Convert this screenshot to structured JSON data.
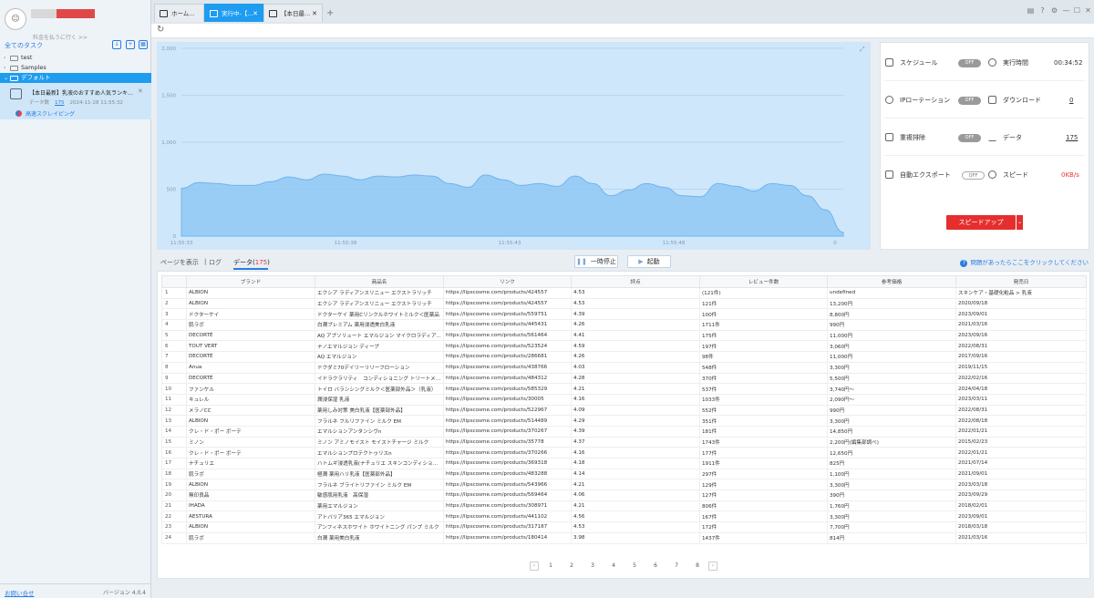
{
  "sidebar": {
    "billing_link": "料金を払うに行く >>",
    "all_tasks": "全てのタスク",
    "folders": [
      {
        "label": "test",
        "chev": "›"
      },
      {
        "label": "Samples",
        "chev": "›"
      },
      {
        "label": "デフォルト",
        "chev": "⌄"
      }
    ],
    "task": {
      "title": "【本日最新】乳液のおすすめ人気ランキング",
      "count_label": "データ数",
      "count": "175",
      "timestamp": "2024-11-28 11:55:32",
      "mode": "高速スクレイピング"
    },
    "contact": "お問い合せ",
    "version": "バージョン 4.0.4"
  },
  "tabs": [
    {
      "label": "ホーム..."
    },
    {
      "label": "実行中-【..."
    },
    {
      "label": "【本日最..."
    }
  ],
  "chart_data": {
    "type": "area",
    "x": [
      "11:55:33",
      "11:55:38",
      "11:55:43",
      "11:55:48"
    ],
    "x_end_label": "0",
    "ylim": [
      0,
      2000
    ],
    "yticks": [
      "2,000",
      "1,500",
      "1,000",
      "500",
      "0"
    ],
    "series": [
      {
        "values": [
          510,
          570,
          560,
          540,
          540,
          580,
          630,
          600,
          660,
          640,
          600,
          640,
          630,
          650,
          640,
          560,
          520,
          650,
          600,
          540,
          560,
          530,
          640,
          560,
          430,
          490,
          560,
          520,
          430,
          420,
          560,
          530,
          480,
          560,
          540,
          430,
          280,
          40
        ]
      }
    ]
  },
  "stats": {
    "schedule": {
      "label": "スケジュール",
      "toggle": "OFF"
    },
    "run_time": {
      "label": "実行時間",
      "value": "00:34:52"
    },
    "ip_rotation": {
      "label": "IPローテーション",
      "toggle": "OFF"
    },
    "download": {
      "label": "ダウンロード",
      "value": "0"
    },
    "dedupe": {
      "label": "重複排除",
      "toggle": "OFF"
    },
    "data": {
      "label": "データ",
      "value": "175"
    },
    "auto_export": {
      "label": "自動エクスポート",
      "toggle": "OFF"
    },
    "speed": {
      "label": "スピード",
      "value": "0KB/s"
    },
    "speedup_button": "スピードアップ"
  },
  "data_tabs": {
    "page": "ページを表示",
    "sep": "|",
    "log": "ログ",
    "data_prefix": "データ(",
    "data_count": "175",
    "data_suffix": ")"
  },
  "controls": {
    "pause": "一時停止",
    "start": "起動",
    "help": "問題があったらここをクリックしてください"
  },
  "table": {
    "headers": [
      "",
      "ブランド",
      "商品名",
      "リンク",
      "評点",
      "レビュー件数",
      "参考価格",
      "発売日"
    ],
    "rows": [
      [
        "1",
        "ALBION",
        "エクシア ラディアンスリニュー エクストラリッチ",
        "https://lipscosme.com/products/424557",
        "4.53",
        "(121件)",
        "undefined",
        "スキンケア・基礎化粧品 > 乳液"
      ],
      [
        "2",
        "ALBION",
        "エクシア ラディアンスリニュー エクストラリッチ",
        "https://lipscosme.com/products/424557",
        "4.53",
        "121件",
        "13,200円",
        "2020/09/18"
      ],
      [
        "3",
        "ドクターケイ",
        "ドクターケイ 薬用Cリンクルホワイトミルク＜医薬品",
        "https://lipscosme.com/products/559751",
        "4.39",
        "100件",
        "8,800円",
        "2023/09/01"
      ],
      [
        "4",
        "肌ラボ",
        "白潤プレミアム 薬用浸透美白乳液",
        "https://lipscosme.com/products/445431",
        "4.26",
        "1711件",
        "990円",
        "2021/03/16"
      ],
      [
        "5",
        "DECORTÉ",
        "AQ アブソリュート エマルジョン マイクロラディアンス",
        "https://lipscosme.com/products/561464",
        "4.41",
        "175件",
        "11,000円",
        "2023/09/16"
      ],
      [
        "6",
        "TOUT VERT",
        "ナノエマルジョン ディープ",
        "https://lipscosme.com/products/523524",
        "4.59",
        "197件",
        "3,060円",
        "2022/08/31"
      ],
      [
        "7",
        "DECORTÉ",
        "AQ エマルジョン",
        "https://lipscosme.com/products/286681",
        "4.26",
        "98件",
        "11,000円",
        "2017/09/16"
      ],
      [
        "8",
        "Anua",
        "ドクダミ70デイリーリリーフローション",
        "https://lipscosme.com/products/438766",
        "4.03",
        "548件",
        "3,300円",
        "2019/11/15"
      ],
      [
        "9",
        "DECORTÉ",
        "イドラクラリティ　コンディショニング トリートメント",
        "https://lipscosme.com/products/484312",
        "4.28",
        "370件",
        "5,500円",
        "2022/02/16"
      ],
      [
        "10",
        "ファンケル",
        "トイロ バランシングミルク＜医薬部外品＞（乳液）",
        "https://lipscosme.com/products/585329",
        "4.21",
        "537件",
        "3,740円〜",
        "2024/04/18"
      ],
      [
        "11",
        "キュレル",
        "潤浸保湿 乳液",
        "https://lipscosme.com/products/30005",
        "4.16",
        "1033件",
        "2,090円〜",
        "2023/03/11"
      ],
      [
        "12",
        "メラノCC",
        "薬用しみ対策 美白乳液【医薬部外品】",
        "https://lipscosme.com/products/522967",
        "4.09",
        "552件",
        "990円",
        "2022/08/31"
      ],
      [
        "13",
        "ALBION",
        "フラルネ フルリファイン ミルク EM",
        "https://lipscosme.com/products/514489",
        "4.29",
        "351件",
        "3,300円",
        "2022/08/18"
      ],
      [
        "14",
        "クレ・ド・ポー ボーテ",
        "エマルションアンタンシヴn",
        "https://lipscosme.com/products/370267",
        "4.39",
        "181件",
        "14,850円",
        "2022/01/21"
      ],
      [
        "15",
        "ミノン",
        "ミノン アミノモイスト モイストチャージ ミルク",
        "https://lipscosme.com/products/35778",
        "4.37",
        "1743件",
        "2,200円(編集部調べ)",
        "2015/02/23"
      ],
      [
        "16",
        "クレ・ド・ポー ボーテ",
        "エマルションプロテクトゥリスn",
        "https://lipscosme.com/products/370266",
        "4.16",
        "177件",
        "12,650円",
        "2022/01/21"
      ],
      [
        "17",
        "ナチュリエ",
        "ハトムギ浸透乳液(ナチュリエ スキンコンディショニング",
        "https://lipscosme.com/products/369318",
        "4.18",
        "1911件",
        "825円",
        "2021/07/14"
      ],
      [
        "18",
        "肌ラボ",
        "極潤 薬用ハリ乳液【医薬部外品】",
        "https://lipscosme.com/products/483288",
        "4.14",
        "297件",
        "1,100円",
        "2021/09/01"
      ],
      [
        "19",
        "ALBION",
        "フラルネ ブライトリファイン ミルク EM",
        "https://lipscosme.com/products/543966",
        "4.21",
        "129件",
        "3,300円",
        "2023/03/18"
      ],
      [
        "20",
        "無印良品",
        "敏感肌用乳液　高保湿",
        "https://lipscosme.com/products/569464",
        "4.06",
        "127件",
        "390円",
        "2023/09/29"
      ],
      [
        "21",
        "IHADA",
        "薬用エマルジョン",
        "https://lipscosme.com/products/308971",
        "4.21",
        "806件",
        "1,760円",
        "2018/02/01"
      ],
      [
        "22",
        "AESTURA",
        "アトバリア365 エマルジョン",
        "https://lipscosme.com/products/441102",
        "4.56",
        "167件",
        "3,300円",
        "2023/09/01"
      ],
      [
        "23",
        "ALBION",
        "アンフィネスホワイト ホワイトニング パンプ ミルク",
        "https://lipscosme.com/products/317187",
        "4.53",
        "172件",
        "7,700円",
        "2018/03/18"
      ],
      [
        "24",
        "肌ラボ",
        "白潤 薬用美白乳液",
        "https://lipscosme.com/products/180414",
        "3.98",
        "1437件",
        "814円",
        "2021/03/16"
      ]
    ]
  },
  "pagination": {
    "prev": "‹",
    "next": "›",
    "pages": [
      "1",
      "2",
      "3",
      "4",
      "5",
      "6",
      "7",
      "8"
    ]
  }
}
